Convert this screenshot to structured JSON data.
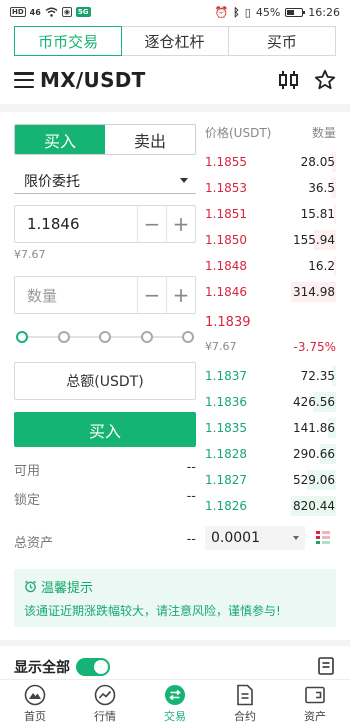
{
  "status_bar": {
    "left_chips": [
      "HD",
      "46",
      "5G"
    ],
    "battery": "45%",
    "time": "16:26"
  },
  "tabs": [
    {
      "label": "币币交易",
      "active": true
    },
    {
      "label": "逐仓杠杆",
      "active": false
    },
    {
      "label": "买币",
      "active": false
    }
  ],
  "header": {
    "pair": "MX/USDT",
    "icons": [
      "menu-icon",
      "candlestick-icon",
      "star-icon"
    ]
  },
  "order_form": {
    "buy_label": "买入",
    "sell_label": "卖出",
    "side": "buy",
    "order_type": "限价委托",
    "price_value": "1.1846",
    "fiat_estimate": "¥7.67",
    "qty_placeholder": "数量",
    "minus": "−",
    "plus": "+",
    "slider_percent": 0,
    "total_label": "总额(USDT)",
    "submit_label": "买入",
    "available_label": "可用",
    "available_value": "--",
    "frozen_label": "锁定",
    "frozen_value": "--",
    "assets_label": "总资产",
    "assets_value": "--"
  },
  "order_book": {
    "price_header": "价格(USDT)",
    "qty_header": "数量",
    "asks": [
      {
        "price": "1.1855",
        "amount": "28.05",
        "depth": 0.09
      },
      {
        "price": "1.1853",
        "amount": "36.5",
        "depth": 0.12
      },
      {
        "price": "1.1851",
        "amount": "15.81",
        "depth": 0.05
      },
      {
        "price": "1.1850",
        "amount": "155.94",
        "depth": 0.5
      },
      {
        "price": "1.1848",
        "amount": "16.2",
        "depth": 0.05
      },
      {
        "price": "1.1846",
        "amount": "314.98",
        "depth": 1.0
      }
    ],
    "last_price": "1.1839",
    "last_fiat": "¥7.67",
    "change": "-3.75%",
    "bids": [
      {
        "price": "1.1837",
        "amount": "72.35",
        "depth": 0.09
      },
      {
        "price": "1.1836",
        "amount": "426.56",
        "depth": 0.52
      },
      {
        "price": "1.1835",
        "amount": "141.86",
        "depth": 0.17
      },
      {
        "price": "1.1828",
        "amount": "290.66",
        "depth": 0.35
      },
      {
        "price": "1.1827",
        "amount": "529.06",
        "depth": 0.64
      },
      {
        "price": "1.1826",
        "amount": "820.44",
        "depth": 1.0
      }
    ],
    "depth_step": "0.0001"
  },
  "notice": {
    "title": "温馨提示",
    "text": "该通证近期涨跌幅较大，请注意风险，谨慎参与!"
  },
  "orders_section": {
    "show_all_label": "显示全部",
    "show_all_on": true
  },
  "bottom_nav": [
    {
      "label": "首页",
      "icon": "home-icon",
      "active": false
    },
    {
      "label": "行情",
      "icon": "market-icon",
      "active": false
    },
    {
      "label": "交易",
      "icon": "trade-icon",
      "active": true
    },
    {
      "label": "合约",
      "icon": "contract-icon",
      "active": false
    },
    {
      "label": "资产",
      "icon": "wallet-icon",
      "active": false
    }
  ],
  "colors": {
    "accent": "#15b374",
    "sell": "#d6263f",
    "notice_bg": "#ecf8f3"
  }
}
